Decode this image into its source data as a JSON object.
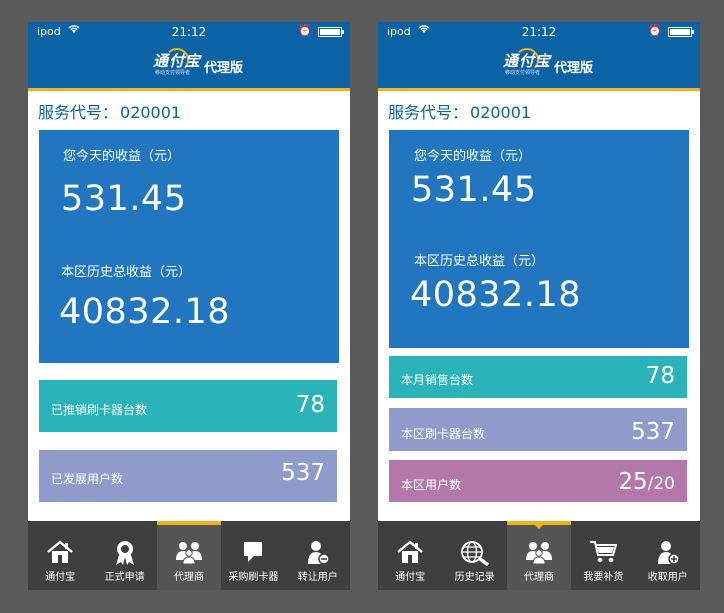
{
  "colors": {
    "brand_blue": "#0b63a5",
    "panel_blue": "#2176bf",
    "accent_gold": "#f0b21a",
    "teal": "#2ab3b8",
    "lavender": "#8e9bcb",
    "mauve": "#b378a9",
    "tabbar": "#3f3f3f",
    "tabbar_active": "#555555",
    "background": "#5a5a5a"
  },
  "left": {
    "status": {
      "carrier": "ipod",
      "time": "21:12"
    },
    "header": {
      "logo": "通付宝",
      "logo_sub": "移动支付领导者",
      "edition": "代理版"
    },
    "service_code": {
      "label": "服务代号：",
      "value": "020001"
    },
    "earnings": {
      "today_label": "您今天的收益（元）",
      "today_value": "531.45",
      "history_label": "本区历史总收益（元）",
      "history_value": "40832.18"
    },
    "stats": [
      {
        "label": "已推销刷卡器台数",
        "value": "78",
        "color": "#2ab3b8"
      },
      {
        "label": "已发展用户数",
        "value": "537",
        "color": "#8e9bcb"
      }
    ],
    "tabs": [
      {
        "label": "通付宝",
        "icon": "home-icon"
      },
      {
        "label": "正式申请",
        "icon": "ribbon-icon"
      },
      {
        "label": "代理商",
        "icon": "agents-icon",
        "active": true
      },
      {
        "label": "采购刷卡器",
        "icon": "chat-icon"
      },
      {
        "label": "转让用户",
        "icon": "user-transfer-icon"
      }
    ]
  },
  "right": {
    "status": {
      "carrier": "ipod",
      "time": "21:12"
    },
    "header": {
      "logo": "通付宝",
      "logo_sub": "移动支付领导者",
      "edition": "代理版"
    },
    "service_code": {
      "label": "服务代号：",
      "value": "020001"
    },
    "earnings": {
      "today_label": "您今天的收益（元）",
      "today_value": "531.45",
      "history_label": "本区历史总收益（元）",
      "history_value": "40832.18"
    },
    "stats": [
      {
        "label": "本月销售台数",
        "value": "78",
        "color": "#2ab3b8"
      },
      {
        "label": "本区刷卡器台数",
        "value": "537",
        "color": "#8e9bcb"
      },
      {
        "label": "本区用户数",
        "value": "25",
        "value_small": "/20",
        "color": "#b378a9"
      }
    ],
    "tabs": [
      {
        "label": "通付宝",
        "icon": "home-icon"
      },
      {
        "label": "历史记录",
        "icon": "globe-search-icon"
      },
      {
        "label": "代理商",
        "icon": "agents-icon",
        "active": true
      },
      {
        "label": "我要补货",
        "icon": "cart-icon"
      },
      {
        "label": "收取用户",
        "icon": "user-add-icon"
      }
    ]
  }
}
